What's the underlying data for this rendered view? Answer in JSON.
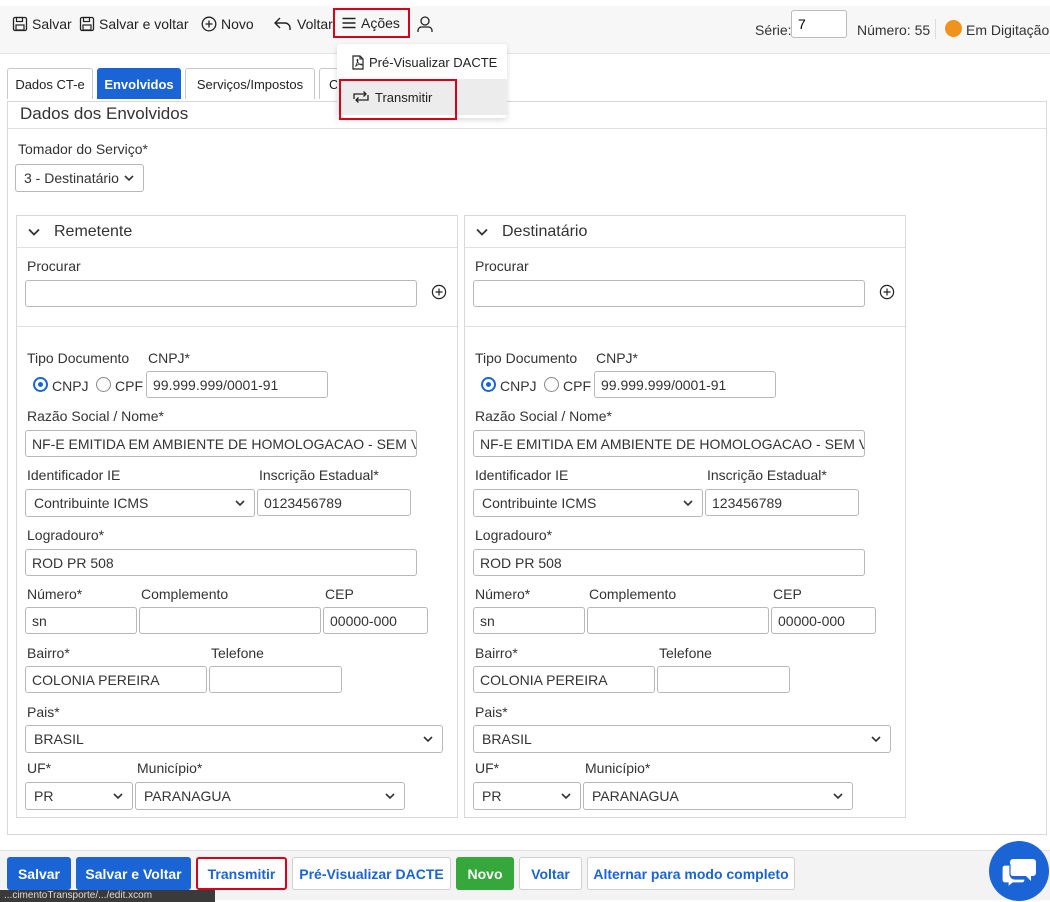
{
  "toolbar": {
    "salvar": "Salvar",
    "salvar_voltar": "Salvar e voltar",
    "novo": "Novo",
    "voltar": "Voltar",
    "acoes": "Ações",
    "serie_label": "Série:",
    "serie_value": "7",
    "numero_label": "Número: 55",
    "status": "Em Digitação"
  },
  "acoes_menu": {
    "preview": "Pré-Visualizar DACTE",
    "transmitir": "Transmitir"
  },
  "tabs": {
    "dados_cte": "Dados CT-e",
    "envolvidos": "Envolvidos",
    "servicos": "Serviços/Impostos",
    "partial": "C"
  },
  "panel": {
    "title": "Dados dos Envolvidos",
    "tomador_label": "Tomador do Serviço*",
    "tomador_value": "3 - Destinatário"
  },
  "labels": {
    "procurar": "Procurar",
    "tipo_documento": "Tipo Documento",
    "cnpj_star": "CNPJ*",
    "cnpj": "CNPJ",
    "cpf": "CPF",
    "razao_social": "Razão Social / Nome*",
    "identificador_ie": "Identificador IE",
    "inscricao_estadual": "Inscrição Estadual*",
    "logradouro": "Logradouro*",
    "numero": "Número*",
    "complemento": "Complemento",
    "cep": "CEP",
    "bairro": "Bairro*",
    "telefone": "Telefone",
    "pais": "Pais*",
    "uf": "UF*",
    "municipio": "Município*"
  },
  "remetente": {
    "title": "Remetente",
    "procurar": "",
    "cnpj": "99.999.999/0001-91",
    "razao_social": "NF-E EMITIDA EM AMBIENTE DE HOMOLOGACAO - SEM VALOR FISCAL",
    "identificador_ie": "Contribuinte ICMS",
    "inscricao_estadual": "0123456789",
    "logradouro": "ROD PR 508",
    "numero": "sn",
    "complemento": "",
    "cep": "00000-000",
    "bairro": "COLONIA PEREIRA",
    "telefone": "",
    "pais": "BRASIL",
    "uf": "PR",
    "municipio": "PARANAGUA"
  },
  "destinatario": {
    "title": "Destinatário",
    "procurar": "",
    "cnpj": "99.999.999/0001-91",
    "razao_social": "NF-E EMITIDA EM AMBIENTE DE HOMOLOGACAO - SEM VALOR FISCAL",
    "identificador_ie": "Contribuinte ICMS",
    "inscricao_estadual": "123456789",
    "logradouro": "ROD PR 508",
    "numero": "sn",
    "complemento": "",
    "cep": "00000-000",
    "bairro": "COLONIA PEREIRA",
    "telefone": "",
    "pais": "BRASIL",
    "uf": "PR",
    "municipio": "PARANAGUA"
  },
  "bottom": {
    "salvar": "Salvar",
    "salvar_voltar": "Salvar e Voltar",
    "transmitir": "Transmitir",
    "preview": "Pré-Visualizar DACTE",
    "novo": "Novo",
    "voltar": "Voltar",
    "alternar": "Alternar para modo completo"
  },
  "status_url": "...cimentoTransporte/.../edit.xcom",
  "colors": {
    "primary": "#1b64d6",
    "success": "#35a73b",
    "highlight": "#d9001b",
    "status_orange": "#f0931e"
  }
}
